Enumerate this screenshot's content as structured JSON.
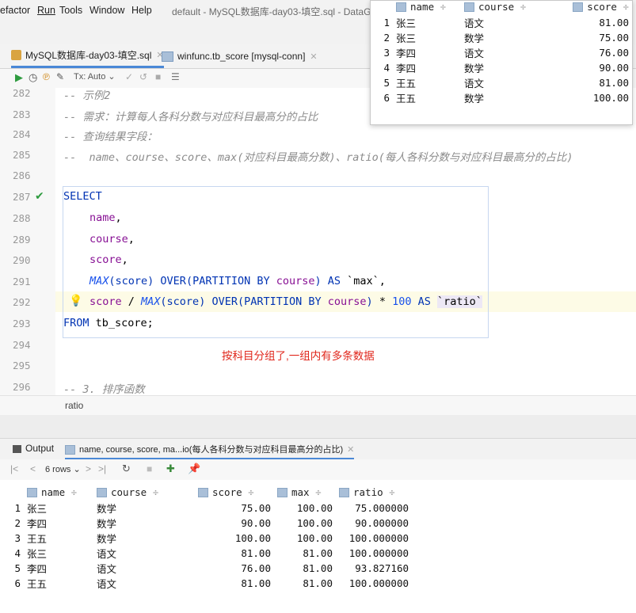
{
  "menu": {
    "items": [
      "efactor",
      "Run",
      "Tools",
      "Window",
      "Help"
    ],
    "window_title": "default - MySQL数据库-day03-填空.sql - DataGrip"
  },
  "tabs": [
    {
      "label": "MySQL数据库-day03-填空.sql",
      "active": true
    },
    {
      "label": "winfunc.tb_score [mysql-conn]",
      "active": false
    }
  ],
  "toolbar": {
    "tx": "Tx: Auto"
  },
  "editor": {
    "line_numbers": [
      "282",
      "283",
      "284",
      "285",
      "286",
      "287",
      "288",
      "289",
      "290",
      "291",
      "292",
      "293",
      "294",
      "295",
      "296"
    ],
    "comment_282": "-- 示例2",
    "comment_283": "-- 需求：计算每人各科分数与对应科目最高分的占比",
    "comment_284": "-- 查询结果字段：",
    "comment_285a": "--  ",
    "comment_285b": "name、course、score、max",
    "comment_285c": "(对应科目最高分数)、",
    "comment_285d": "ratio",
    "comment_285e": "(每人各科分数与对应科目最高分的占比)",
    "kw_select": "SELECT",
    "col_name": "name",
    "col_course": "course",
    "col_score": "score",
    "comma": ",",
    "fn_max": "MAX",
    "over_291a": "(score) ",
    "over_kw": "OVER",
    "partition": "(PARTITION BY ",
    "course_291": "course",
    "close_as": ") AS ",
    "alias_max": "`max`",
    "score_292": "score",
    "slash": " / ",
    "times": " * ",
    "hundred": "100",
    "as_292": " AS ",
    "alias_ratio": "`ratio`",
    "kw_from": "FROM",
    "table": " tb_score;",
    "comment_296": "-- 3. 排序函数",
    "annotation": "按科目分组了,一组内有多条数据",
    "breadcrumb": "ratio"
  },
  "output": {
    "tab_output": "Output",
    "tab_result": "name, course, score, ma...io(每人各科分数与对应科目最高分的占比)",
    "rows_label": "6 rows",
    "columns": [
      "name",
      "course",
      "score",
      "max",
      "ratio"
    ],
    "rows": [
      {
        "n": "1",
        "name": "张三",
        "course": "数学",
        "score": "75.00",
        "max": "100.00",
        "ratio": "75.000000"
      },
      {
        "n": "2",
        "name": "李四",
        "course": "数学",
        "score": "90.00",
        "max": "100.00",
        "ratio": "90.000000"
      },
      {
        "n": "3",
        "name": "王五",
        "course": "数学",
        "score": "100.00",
        "max": "100.00",
        "ratio": "100.000000"
      },
      {
        "n": "4",
        "name": "张三",
        "course": "语文",
        "score": "81.00",
        "max": "81.00",
        "ratio": "100.000000"
      },
      {
        "n": "5",
        "name": "李四",
        "course": "语文",
        "score": "76.00",
        "max": "81.00",
        "ratio": "93.827160"
      },
      {
        "n": "6",
        "name": "王五",
        "course": "语文",
        "score": "81.00",
        "max": "81.00",
        "ratio": "100.000000"
      }
    ]
  },
  "popup": {
    "columns": [
      "name",
      "course",
      "score"
    ],
    "rows": [
      {
        "n": "1",
        "name": "张三",
        "course": "语文",
        "score": "81.00"
      },
      {
        "n": "2",
        "name": "张三",
        "course": "数学",
        "score": "75.00"
      },
      {
        "n": "3",
        "name": "李四",
        "course": "语文",
        "score": "76.00"
      },
      {
        "n": "4",
        "name": "李四",
        "course": "数学",
        "score": "90.00"
      },
      {
        "n": "5",
        "name": "王五",
        "course": "语文",
        "score": "81.00"
      },
      {
        "n": "6",
        "name": "王五",
        "course": "数学",
        "score": "100.00"
      }
    ]
  },
  "colors": {
    "accent": "#4a88d6",
    "keyword": "#0033b3",
    "field": "#871094",
    "annotation": "#e0261b",
    "run": "#2e9b3f"
  }
}
